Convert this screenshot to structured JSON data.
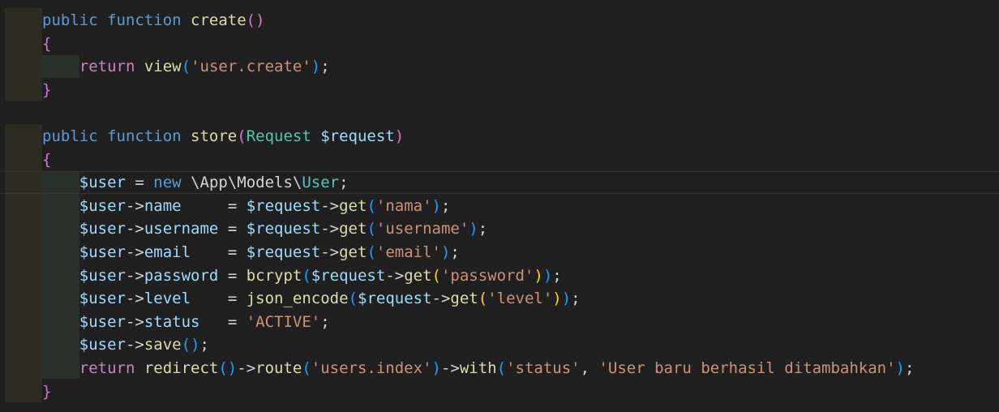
{
  "editor": {
    "language": "php",
    "lines": [
      [
        {
          "t": "public function ",
          "c": "kw"
        },
        {
          "t": "create",
          "c": "fn"
        },
        {
          "t": "()",
          "c": "p2"
        }
      ],
      [
        {
          "t": "{",
          "c": "p2"
        }
      ],
      [
        {
          "t": "    "
        },
        {
          "t": "return ",
          "c": "ctl"
        },
        {
          "t": "view",
          "c": "fn"
        },
        {
          "t": "(",
          "c": "p3"
        },
        {
          "t": "'user.create'",
          "c": "str"
        },
        {
          "t": ")",
          "c": "p3"
        },
        {
          "t": ";",
          "c": "pl"
        }
      ],
      [
        {
          "t": "}",
          "c": "p2"
        }
      ],
      [],
      [
        {
          "t": "public function ",
          "c": "kw"
        },
        {
          "t": "store",
          "c": "fn"
        },
        {
          "t": "(",
          "c": "p2"
        },
        {
          "t": "Request ",
          "c": "ty"
        },
        {
          "t": "$request",
          "c": "var"
        },
        {
          "t": ")",
          "c": "p2"
        }
      ],
      [
        {
          "t": "{",
          "c": "p2"
        }
      ],
      [
        {
          "t": "    "
        },
        {
          "t": "$user",
          "c": "var"
        },
        {
          "t": " = ",
          "c": "pl"
        },
        {
          "t": "new ",
          "c": "kw"
        },
        {
          "t": "\\App\\Models\\",
          "c": "pl"
        },
        {
          "t": "User",
          "c": "ty"
        },
        {
          "t": ";",
          "c": "pl"
        }
      ],
      [
        {
          "t": "    "
        },
        {
          "t": "$user",
          "c": "var"
        },
        {
          "t": "->",
          "c": "pl"
        },
        {
          "t": "name",
          "c": "var"
        },
        {
          "t": "     = ",
          "c": "pl"
        },
        {
          "t": "$request",
          "c": "var"
        },
        {
          "t": "->",
          "c": "pl"
        },
        {
          "t": "get",
          "c": "fn"
        },
        {
          "t": "(",
          "c": "p3"
        },
        {
          "t": "'nama'",
          "c": "str"
        },
        {
          "t": ")",
          "c": "p3"
        },
        {
          "t": ";",
          "c": "pl"
        }
      ],
      [
        {
          "t": "    "
        },
        {
          "t": "$user",
          "c": "var"
        },
        {
          "t": "->",
          "c": "pl"
        },
        {
          "t": "username",
          "c": "var"
        },
        {
          "t": " = ",
          "c": "pl"
        },
        {
          "t": "$request",
          "c": "var"
        },
        {
          "t": "->",
          "c": "pl"
        },
        {
          "t": "get",
          "c": "fn"
        },
        {
          "t": "(",
          "c": "p3"
        },
        {
          "t": "'username'",
          "c": "str"
        },
        {
          "t": ")",
          "c": "p3"
        },
        {
          "t": ";",
          "c": "pl"
        }
      ],
      [
        {
          "t": "    "
        },
        {
          "t": "$user",
          "c": "var"
        },
        {
          "t": "->",
          "c": "pl"
        },
        {
          "t": "email",
          "c": "var"
        },
        {
          "t": "    = ",
          "c": "pl"
        },
        {
          "t": "$request",
          "c": "var"
        },
        {
          "t": "->",
          "c": "pl"
        },
        {
          "t": "get",
          "c": "fn"
        },
        {
          "t": "(",
          "c": "p3"
        },
        {
          "t": "'email'",
          "c": "str"
        },
        {
          "t": ")",
          "c": "p3"
        },
        {
          "t": ";",
          "c": "pl"
        }
      ],
      [
        {
          "t": "    "
        },
        {
          "t": "$user",
          "c": "var"
        },
        {
          "t": "->",
          "c": "pl"
        },
        {
          "t": "password",
          "c": "var"
        },
        {
          "t": " = ",
          "c": "pl"
        },
        {
          "t": "bcrypt",
          "c": "fn"
        },
        {
          "t": "(",
          "c": "p3"
        },
        {
          "t": "$request",
          "c": "var"
        },
        {
          "t": "->",
          "c": "pl"
        },
        {
          "t": "get",
          "c": "fn"
        },
        {
          "t": "(",
          "c": "p1"
        },
        {
          "t": "'password'",
          "c": "str"
        },
        {
          "t": ")",
          "c": "p1"
        },
        {
          "t": ")",
          "c": "p3"
        },
        {
          "t": ";",
          "c": "pl"
        }
      ],
      [
        {
          "t": "    "
        },
        {
          "t": "$user",
          "c": "var"
        },
        {
          "t": "->",
          "c": "pl"
        },
        {
          "t": "level",
          "c": "var"
        },
        {
          "t": "    = ",
          "c": "pl"
        },
        {
          "t": "json_encode",
          "c": "fn"
        },
        {
          "t": "(",
          "c": "p3"
        },
        {
          "t": "$request",
          "c": "var"
        },
        {
          "t": "->",
          "c": "pl"
        },
        {
          "t": "get",
          "c": "fn"
        },
        {
          "t": "(",
          "c": "p1"
        },
        {
          "t": "'level'",
          "c": "str"
        },
        {
          "t": ")",
          "c": "p1"
        },
        {
          "t": ")",
          "c": "p3"
        },
        {
          "t": ";",
          "c": "pl"
        }
      ],
      [
        {
          "t": "    "
        },
        {
          "t": "$user",
          "c": "var"
        },
        {
          "t": "->",
          "c": "pl"
        },
        {
          "t": "status",
          "c": "var"
        },
        {
          "t": "   = ",
          "c": "pl"
        },
        {
          "t": "'ACTIVE'",
          "c": "str"
        },
        {
          "t": ";",
          "c": "pl"
        }
      ],
      [
        {
          "t": "    "
        },
        {
          "t": "$user",
          "c": "var"
        },
        {
          "t": "->",
          "c": "pl"
        },
        {
          "t": "save",
          "c": "fn"
        },
        {
          "t": "()",
          "c": "p3"
        },
        {
          "t": ";",
          "c": "pl"
        }
      ],
      [
        {
          "t": "    "
        },
        {
          "t": "return ",
          "c": "ctl"
        },
        {
          "t": "redirect",
          "c": "fn"
        },
        {
          "t": "()",
          "c": "p3"
        },
        {
          "t": "->",
          "c": "pl"
        },
        {
          "t": "route",
          "c": "fn"
        },
        {
          "t": "(",
          "c": "p3"
        },
        {
          "t": "'users.index'",
          "c": "str"
        },
        {
          "t": ")",
          "c": "p3"
        },
        {
          "t": "->",
          "c": "pl"
        },
        {
          "t": "with",
          "c": "fn"
        },
        {
          "t": "(",
          "c": "p3"
        },
        {
          "t": "'status'",
          "c": "str"
        },
        {
          "t": ", ",
          "c": "pl"
        },
        {
          "t": "'User baru berhasil ditambahkan'",
          "c": "str"
        },
        {
          "t": ")",
          "c": "p3"
        },
        {
          "t": ";",
          "c": "pl"
        }
      ],
      [
        {
          "t": "}",
          "c": "p2"
        }
      ]
    ]
  }
}
